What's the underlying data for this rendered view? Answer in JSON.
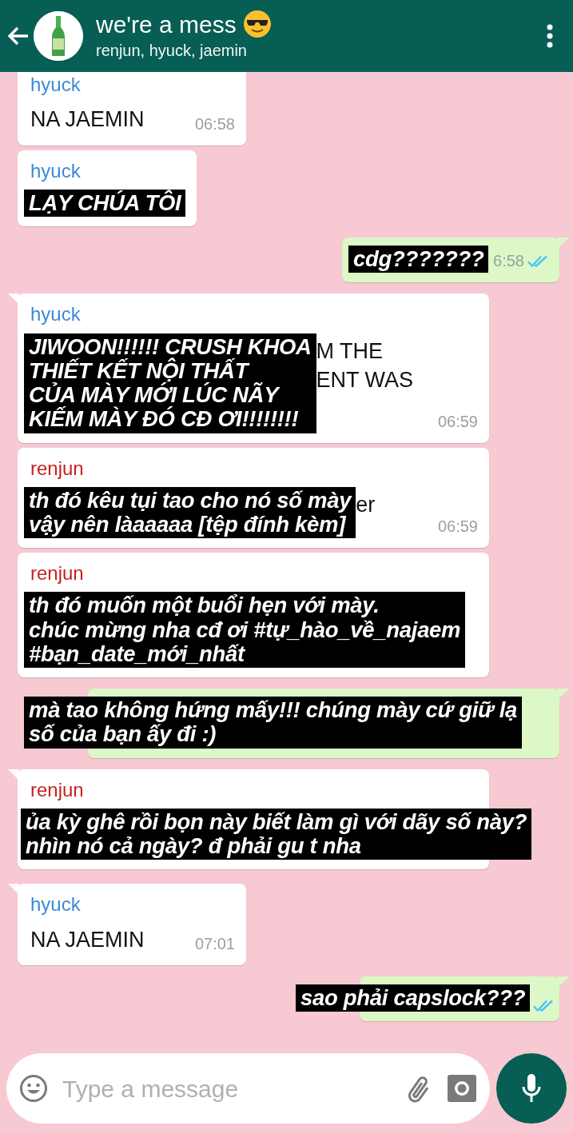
{
  "header": {
    "title": "we're a mess",
    "subtitle": "renjun, hyuck, jaemin"
  },
  "messages": [
    {
      "outgoing": false,
      "sender": {
        "name": "hyuck",
        "color": "#3d8ad6"
      },
      "text": "NA JAEMIN",
      "time": "06:58"
    },
    {
      "outgoing": false,
      "tail": false,
      "sender": {
        "name": "hyuck",
        "color": "#3d8ad6"
      },
      "caption": [
        "LẠY CHÚA TÔI"
      ]
    },
    {
      "outgoing": true,
      "tail": true,
      "caption": [
        "cdg???????"
      ],
      "time": "6:58",
      "read": true
    },
    {
      "outgoing": false,
      "tail": true,
      "sender": {
        "name": "hyuck",
        "color": "#3d8ad6"
      },
      "caption": [
        "JIWOON!!!!!! CRUSH KHOA",
        "THIẾT KẾT NỘI THẤT",
        "CỦA MÀY MỚI LÚC NÃY",
        "KIẾM MÀY ĐÓ CĐ ƠI!!!!!!!!"
      ],
      "fragments": [
        "M THE",
        "ENT WAS"
      ],
      "time": "06:59"
    },
    {
      "outgoing": false,
      "tail": false,
      "sender": {
        "name": "renjun",
        "color": "#c9201f"
      },
      "caption": [
        "th đó kêu tụi tao cho nó số mày",
        "vậy nên làaaaaa [tệp đính kèm]"
      ],
      "fragments": [
        "er"
      ],
      "time": "06:59"
    },
    {
      "outgoing": false,
      "tail": false,
      "sender": {
        "name": "renjun",
        "color": "#c9201f"
      },
      "caption": [
        "th đó muốn một buổi hẹn với mày.",
        "chúc mừng nha cđ ơi #tự_hào_về_najaem",
        "#bạn_date_mới_nhất"
      ]
    },
    {
      "outgoing": true,
      "tail": true,
      "caption": [
        "mà tao không hứng mấy!!! chúng mày cứ giữ lạ",
        "số của bạn ấy đi :)"
      ]
    },
    {
      "outgoing": false,
      "tail": true,
      "sender": {
        "name": "renjun",
        "color": "#c9201f"
      },
      "caption": [
        "ủa kỳ ghê rồi bọn này biết làm gì với dãy số này?",
        "nhìn nó cả ngày? đ phải gu t nha"
      ]
    },
    {
      "outgoing": false,
      "tail": true,
      "sender": {
        "name": "hyuck",
        "color": "#3d8ad6"
      },
      "text": "NA JAEMIN",
      "time": "07:01"
    },
    {
      "outgoing": true,
      "tail": true,
      "caption": [
        "sao phải capslock???"
      ],
      "read": true
    }
  ],
  "composer": {
    "placeholder": "Type a message"
  }
}
